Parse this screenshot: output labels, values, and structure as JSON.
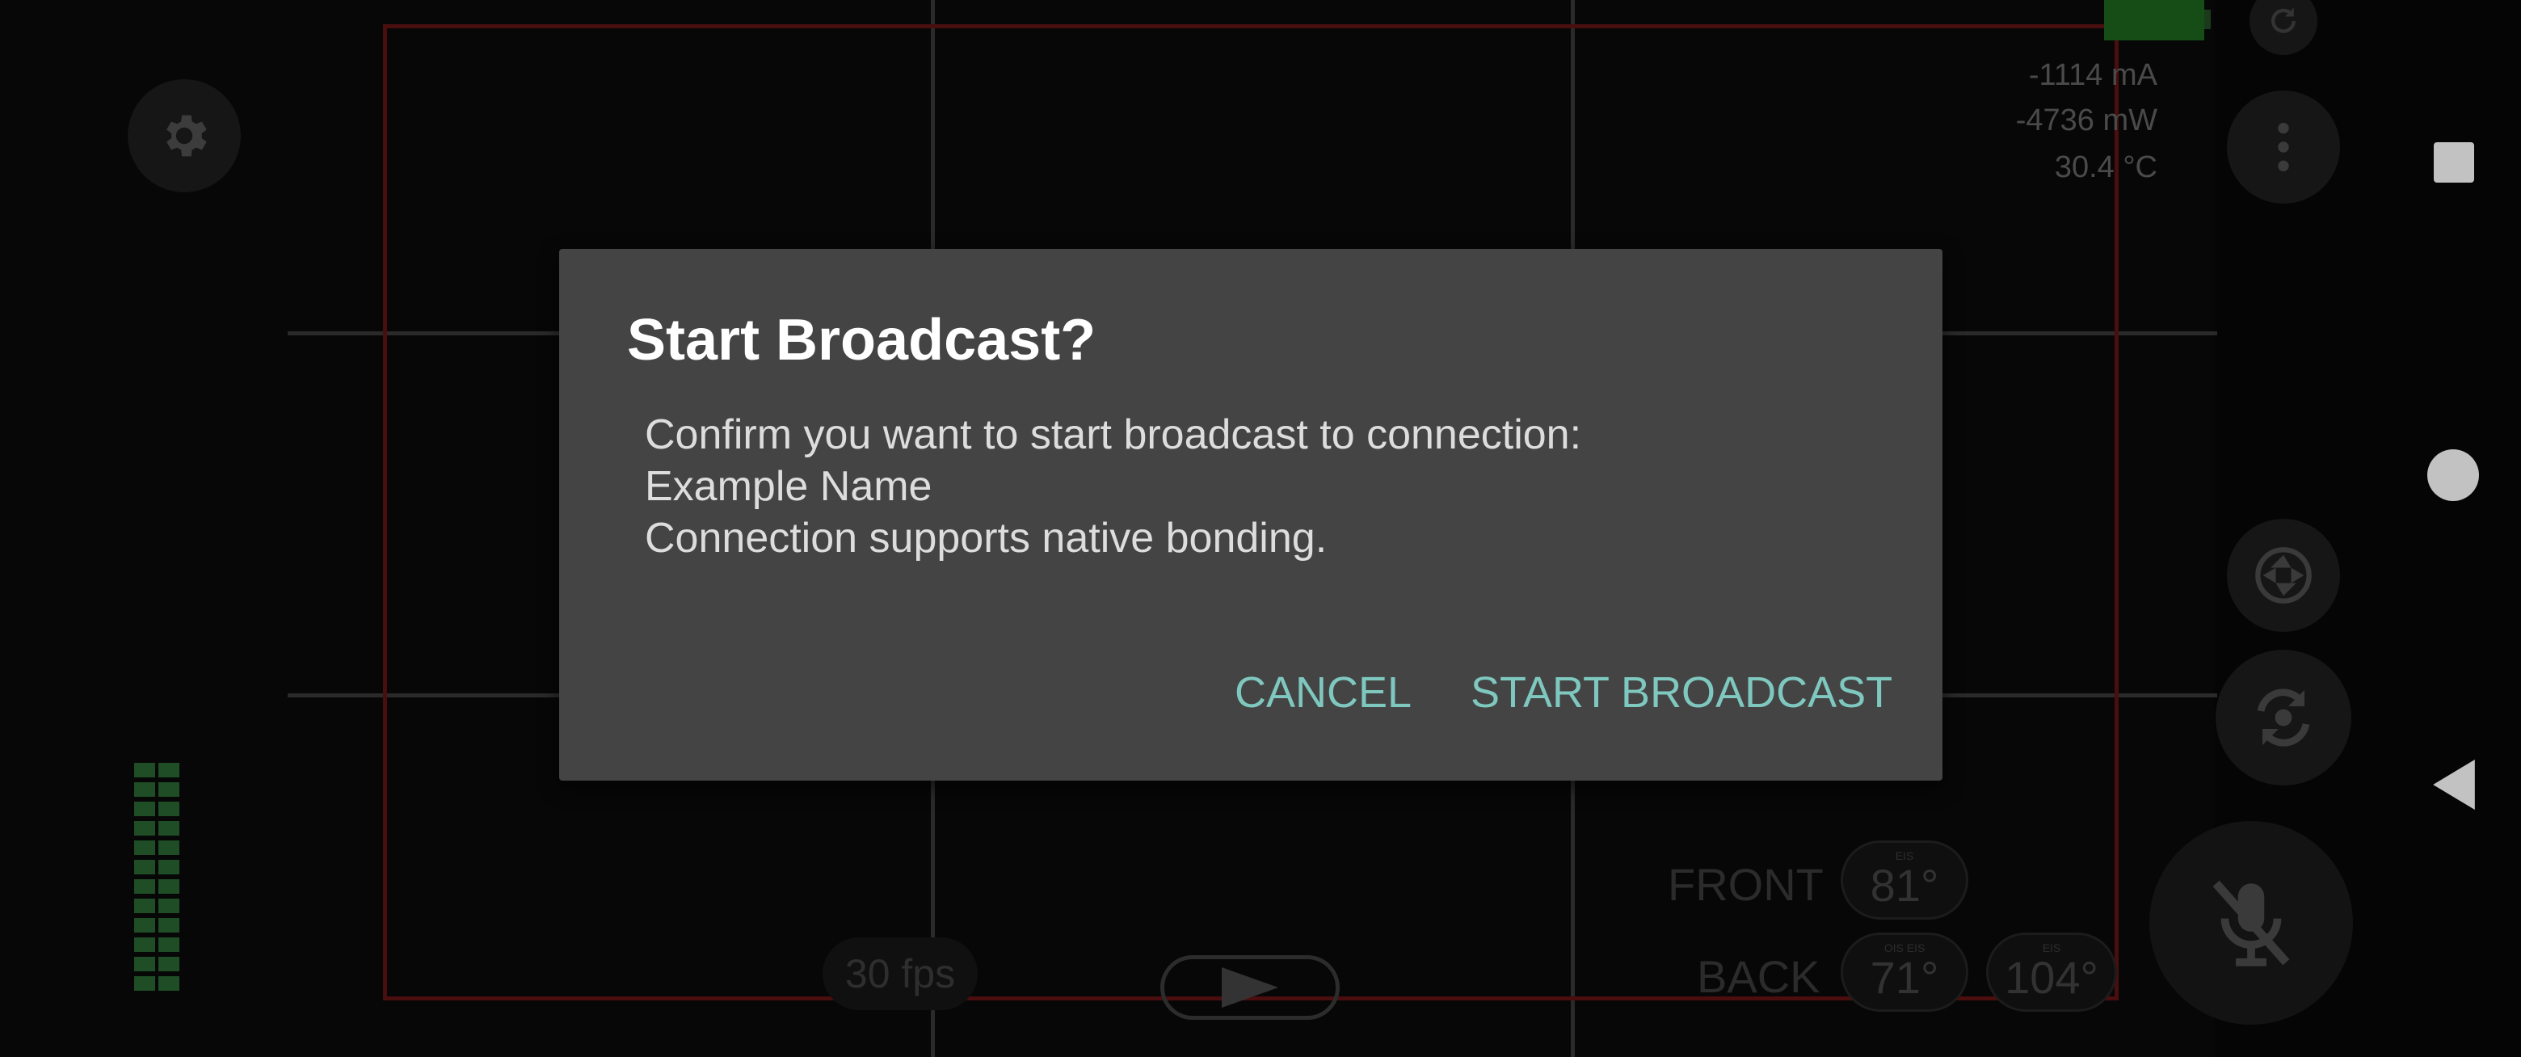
{
  "dialog": {
    "title": "Start Broadcast?",
    "message_lines": [
      "Confirm you want to start broadcast to connection:",
      "Example Name",
      "Connection supports native bonding."
    ],
    "cancel_label": "CANCEL",
    "confirm_label": "START BROADCAST",
    "accent_color": "#7fc8bf"
  },
  "status": {
    "current": "-1114 mA",
    "power": "-4736 mW",
    "temperature": "30.4 °C"
  },
  "camera": {
    "fps": "30 fps",
    "front_label": "FRONT",
    "back_label": "BACK",
    "front_temps": [
      {
        "tag": "EIS",
        "value": "81°"
      }
    ],
    "back_temps": [
      {
        "tag": "OIS EIS",
        "value": "71°"
      },
      {
        "tag": "EIS",
        "value": "104°"
      }
    ]
  },
  "icons": {
    "settings": "gear-icon",
    "refresh": "refresh-icon",
    "menu": "more-vertical-icon",
    "photo": "camera-shutter-icon",
    "flip": "camera-switch-icon",
    "mic": "mic-off-icon",
    "play": "play-icon"
  }
}
